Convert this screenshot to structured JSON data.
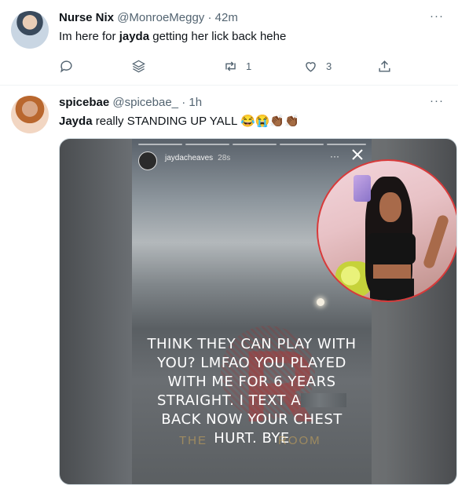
{
  "tweets": [
    {
      "name": "Nurse Nix",
      "handle": "@MonroeMeggy",
      "separator": "·",
      "time": "42m",
      "text_pre": "Im here for ",
      "text_bold": "jayda",
      "text_post": " getting her lick back hehe",
      "retweets": "1",
      "likes": "3",
      "more": "···"
    },
    {
      "name": "spicebae",
      "handle": "@spicebae_",
      "separator": "·",
      "time": "1h",
      "text_bold": "Jayda",
      "text_post": " really STANDING UP YALL 😂😭👏🏾👏🏾",
      "more": "···",
      "media": {
        "story_user": "jaydacheaves",
        "story_time": "28s",
        "story_more": "···",
        "caption_line1": "THINK THEY CAN PLAY WITH",
        "caption_line2": "YOU? LMFAO YOU PLAYED",
        "caption_line3": "WITH ME FOR 6 YEARS",
        "caption_line4": "STRAIGHT. I TEXT A",
        "caption_line5": "BACK NOW YOUR CHEST",
        "caption_line6": "HURT. BYE",
        "watermark_left": "THE",
        "watermark_right": "ROOM"
      }
    }
  ]
}
